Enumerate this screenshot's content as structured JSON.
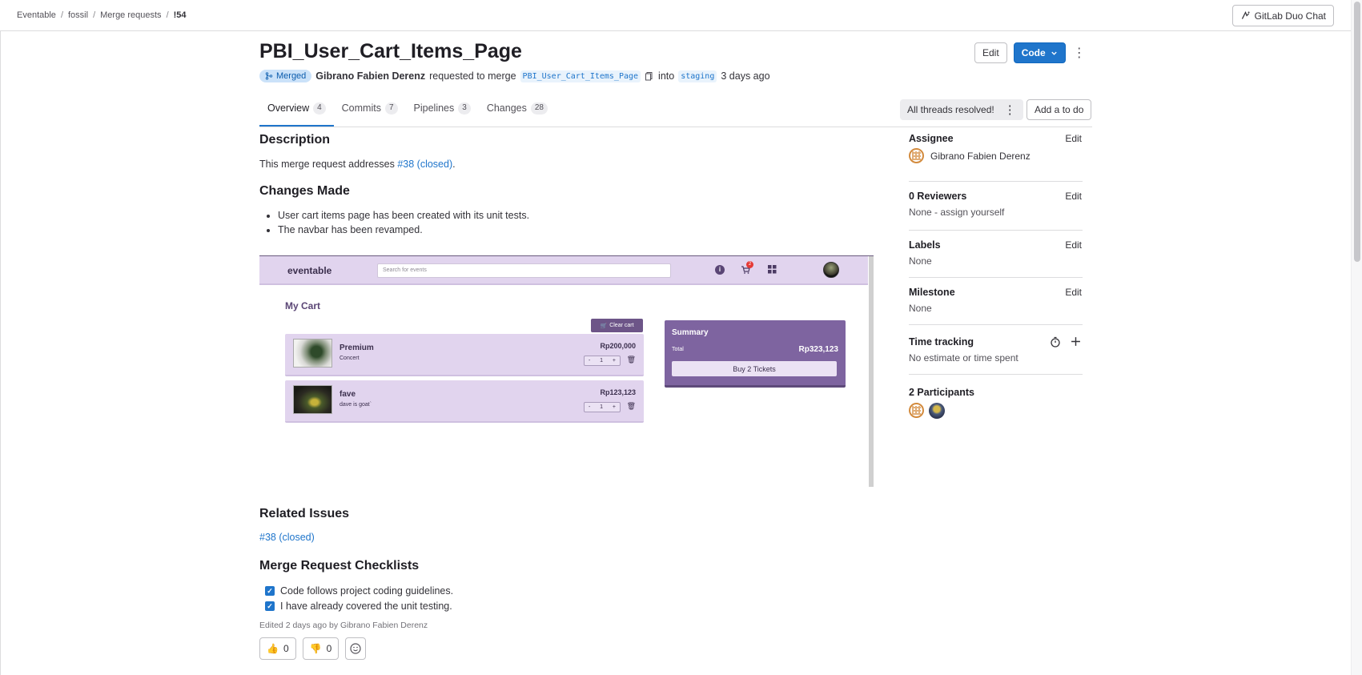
{
  "breadcrumb": [
    "Eventable",
    "fossil",
    "Merge requests",
    "!54"
  ],
  "duo_chat": "GitLab Duo Chat",
  "title": "PBI_User_Cart_Items_Page",
  "actions": {
    "edit": "Edit",
    "code": "Code"
  },
  "meta": {
    "status": "Merged",
    "author": "Gibrano Fabien Derenz",
    "requested": "requested to merge",
    "source_branch": "PBI_User_Cart_Items_Page",
    "into": "into",
    "target_branch": "staging",
    "time": "3 days ago"
  },
  "tabs": [
    {
      "label": "Overview",
      "count": "4"
    },
    {
      "label": "Commits",
      "count": "7"
    },
    {
      "label": "Pipelines",
      "count": "3"
    },
    {
      "label": "Changes",
      "count": "28"
    }
  ],
  "threads": "All threads resolved!",
  "add_todo": "Add a to do",
  "description": {
    "heading": "Description",
    "text_prefix": "This merge request addresses",
    "link": "#38 (closed)",
    "text_suffix": "."
  },
  "changes": {
    "heading": "Changes Made",
    "items": [
      "User cart items page has been created with its unit tests.",
      "The navbar has been revamped."
    ]
  },
  "screenshot": {
    "logo": "eventable",
    "search_placeholder": "Search for events",
    "cart_badge": "2",
    "my_cart": "My Cart",
    "clear_cart": "Clear cart",
    "items": [
      {
        "name": "Premium",
        "sub": "Concert",
        "price": "Rp200,000",
        "qty": "1"
      },
      {
        "name": "fave",
        "sub": "dave is goat`",
        "price": "Rp123,123",
        "qty": "1"
      }
    ],
    "summary": {
      "title": "Summary",
      "total_label": "Total",
      "total": "Rp323,123",
      "buy": "Buy 2 Tickets"
    }
  },
  "related": {
    "heading": "Related Issues",
    "link": "#38 (closed)"
  },
  "checklist": {
    "heading": "Merge Request Checklists",
    "items": [
      "Code follows project coding guidelines.",
      "I have already covered the unit testing."
    ]
  },
  "edited": "Edited 2 days ago by Gibrano Fabien Derenz",
  "reactions": {
    "up": "0",
    "down": "0"
  },
  "sidebar": {
    "assignee": {
      "label": "Assignee",
      "edit": "Edit",
      "name": "Gibrano Fabien Derenz"
    },
    "reviewers": {
      "label": "0 Reviewers",
      "edit": "Edit",
      "value": "None - assign yourself"
    },
    "labels": {
      "label": "Labels",
      "edit": "Edit",
      "value": "None"
    },
    "milestone": {
      "label": "Milestone",
      "edit": "Edit",
      "value": "None"
    },
    "time": {
      "label": "Time tracking",
      "value": "No estimate or time spent"
    },
    "participants": {
      "label": "2 Participants"
    }
  },
  "colors": {
    "accent": "#1f75cb",
    "merged_badge": "#cbe2f9",
    "app_purple": "#7e64a0"
  }
}
